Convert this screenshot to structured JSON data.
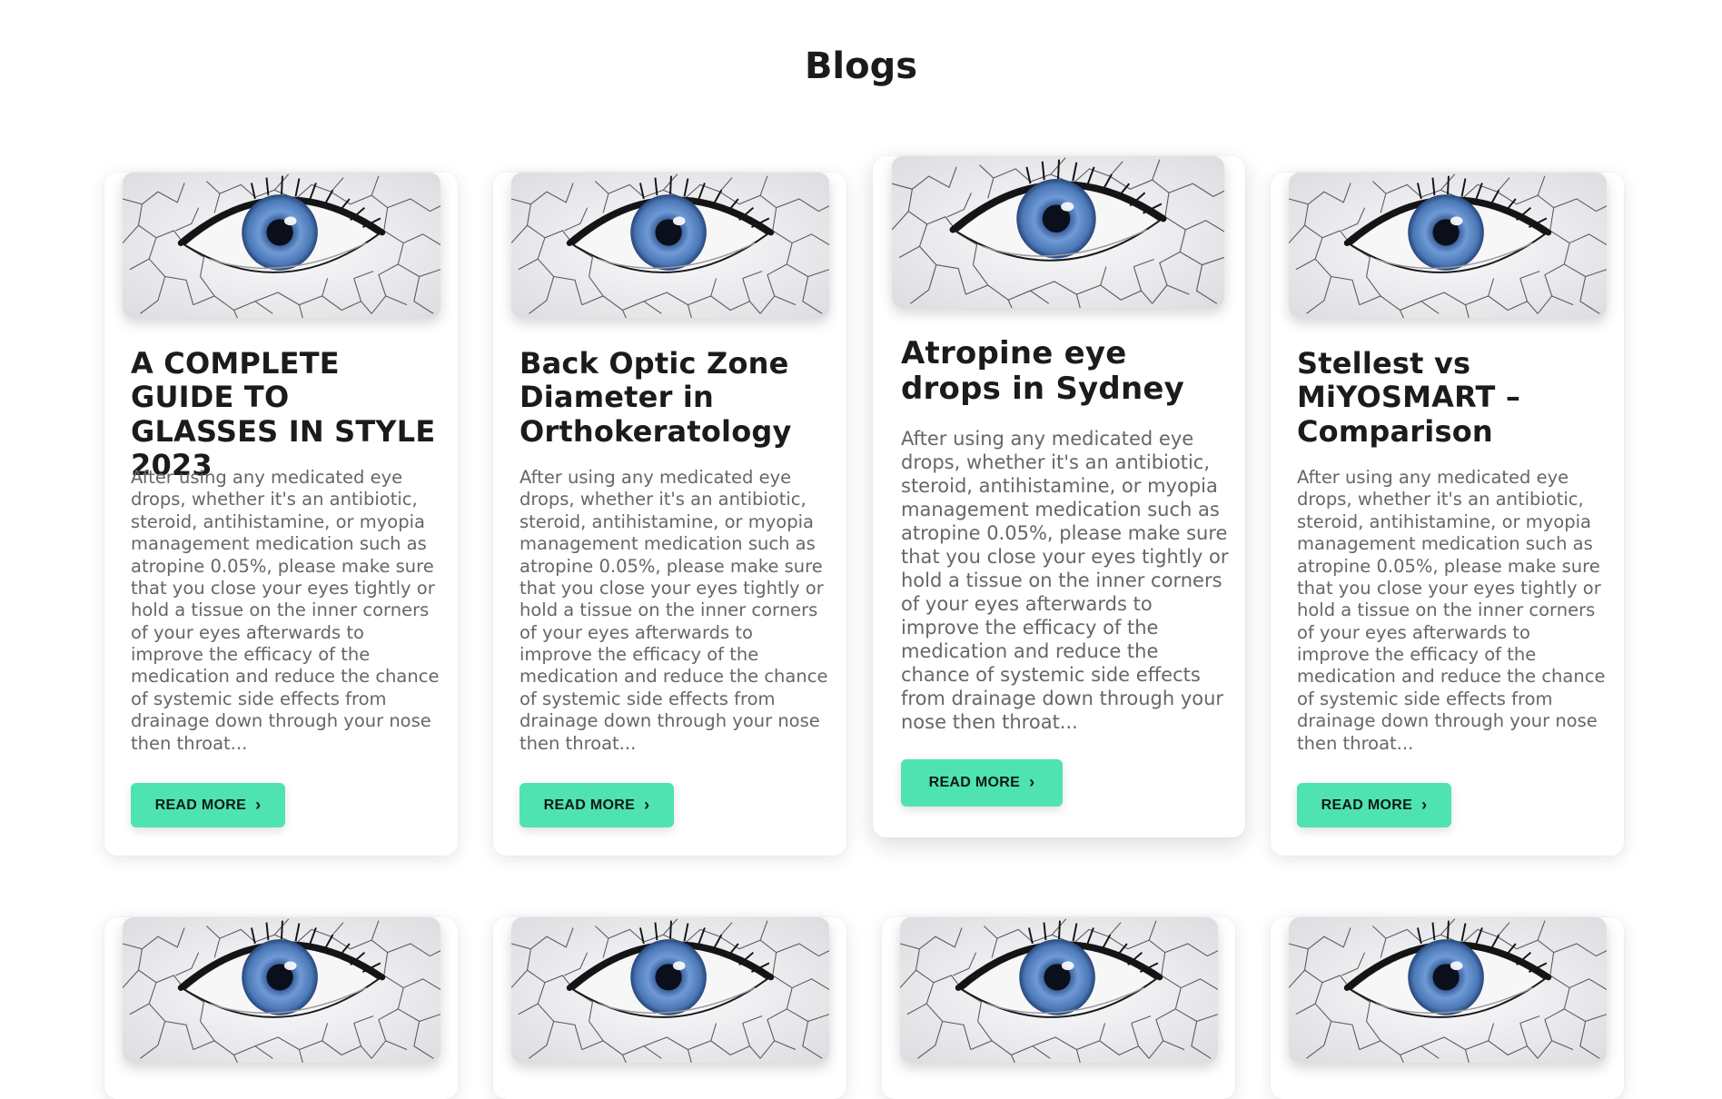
{
  "page": {
    "title": "Blogs"
  },
  "posts": [
    {
      "title": "A COMPLETE GUIDE TO GLASSES IN STYLE 2023",
      "excerpt": "After using any medicated eye drops, whether it's an antibiotic, steroid, antihistamine, or myopia management medication such as atropine 0.05%, please make sure that you close your eyes tightly or hold a tissue on the inner corners of your eyes afterwards to improve the efficacy of the medication and reduce the chance of systemic side effects from drainage down through your nose then throat...",
      "button": "READ MORE",
      "image_icon": "eye-image"
    },
    {
      "title": "Back Optic Zone Diameter in Orthokeratology",
      "excerpt": "After using any medicated eye drops, whether it's an antibiotic, steroid, antihistamine, or myopia management medication such as atropine 0.05%, please make sure that you close your eyes tightly or hold a tissue on the inner corners of your eyes afterwards to improve the efficacy of the medication and reduce the chance of systemic side effects from drainage down through your nose then throat...",
      "button": "READ MORE",
      "image_icon": "eye-image"
    },
    {
      "title": "Atropine eye drops in Sydney",
      "excerpt": "After using any medicated eye drops, whether it's an antibiotic, steroid, antihistamine, or myopia management medication such as atropine 0.05%, please make sure that you close your eyes tightly or hold a tissue on the inner corners of your eyes afterwards to improve the efficacy of the medication and reduce the chance of systemic side effects from drainage down through your nose then throat...",
      "button": "READ MORE",
      "image_icon": "eye-image"
    },
    {
      "title": "Stellest vs MiYOSMART – Comparison",
      "excerpt": "After using any medicated eye drops, whether it's an antibiotic, steroid, antihistamine, or myopia management medication such as atropine 0.05%, please make sure that you close your eyes tightly or hold a tissue on the inner corners of your eyes afterwards to improve the efficacy of the medication and reduce the chance of systemic side effects from drainage down through your nose then throat...",
      "button": "READ MORE",
      "image_icon": "eye-image"
    }
  ],
  "colors": {
    "accent": "#4ee3b1",
    "iris": "#5a86c4",
    "text_muted": "#66666b"
  },
  "icons": {
    "button_chevron": "chevron-right-icon"
  }
}
